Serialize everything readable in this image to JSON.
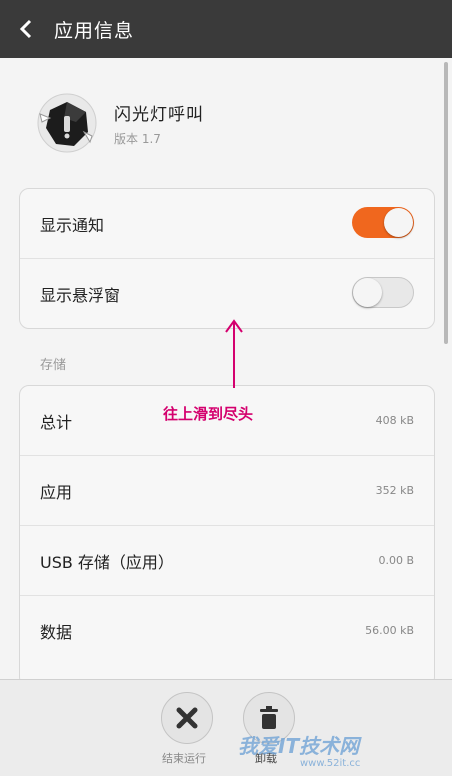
{
  "header": {
    "title": "应用信息"
  },
  "app": {
    "name": "闪光灯呼叫",
    "version": "版本 1.7"
  },
  "settings": [
    {
      "label": "显示通知",
      "state": "on"
    },
    {
      "label": "显示悬浮窗",
      "state": "off"
    }
  ],
  "storage": {
    "section_title": "存储",
    "rows": [
      {
        "label": "总计",
        "value": "408 kB"
      },
      {
        "label": "应用",
        "value": "352 kB"
      },
      {
        "label": "USB 存储（应用）",
        "value": "0.00 B"
      },
      {
        "label": "数据",
        "value": "56.00 kB"
      }
    ]
  },
  "actions": {
    "force_stop": "结束运行",
    "uninstall": "卸载"
  },
  "annotation": {
    "text": "往上滑到尽头",
    "color": "#d4006e"
  },
  "watermark": {
    "text": "我爱IT技术网",
    "url": "www.52it.cc"
  },
  "colors": {
    "accent": "#f0671e",
    "titlebar": "#3a3a3a"
  }
}
